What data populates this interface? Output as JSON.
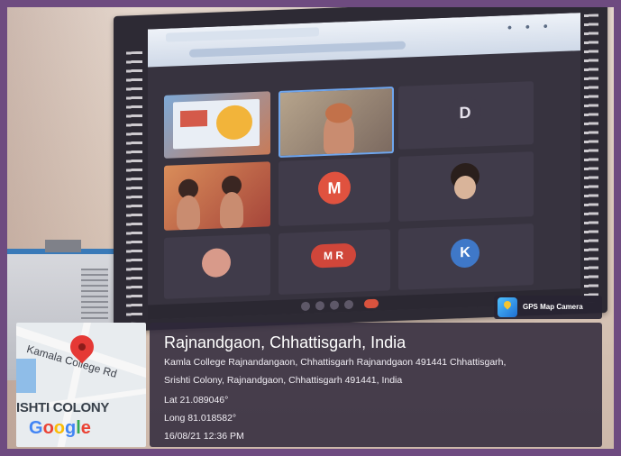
{
  "map": {
    "road_label": "Kamala College Rd",
    "area_label": "ISHTI COLONY",
    "provider": "Google"
  },
  "badge": {
    "label": "GPS Map Camera"
  },
  "location": {
    "title": "Rajnandgaon, Chhattisgarh, India",
    "address_line1": "Kamla College Rajnandangaon, Chhattisgarh Rajnandgaon 491441 Chhattisgarh,",
    "address_line2": "Srishti Colony, Rajnandgaon, Chhattisgarh 491441, India",
    "lat": "Lat 21.089046°",
    "long": "Long 81.018582°",
    "datetime": "16/08/21 12:36 PM"
  },
  "meeting": {
    "tiles": [
      {
        "avatar": "D"
      },
      {
        "avatar": "M"
      },
      {
        "avatar": "M R"
      },
      {
        "avatar": "K"
      }
    ]
  },
  "colors": {
    "frame": "#6e4b80",
    "info_bg": "#2e283a",
    "pin": "#e53935",
    "google_blue": "#4285f4",
    "google_red": "#ea4335",
    "google_yellow": "#fbbc05",
    "google_green": "#34a853"
  }
}
